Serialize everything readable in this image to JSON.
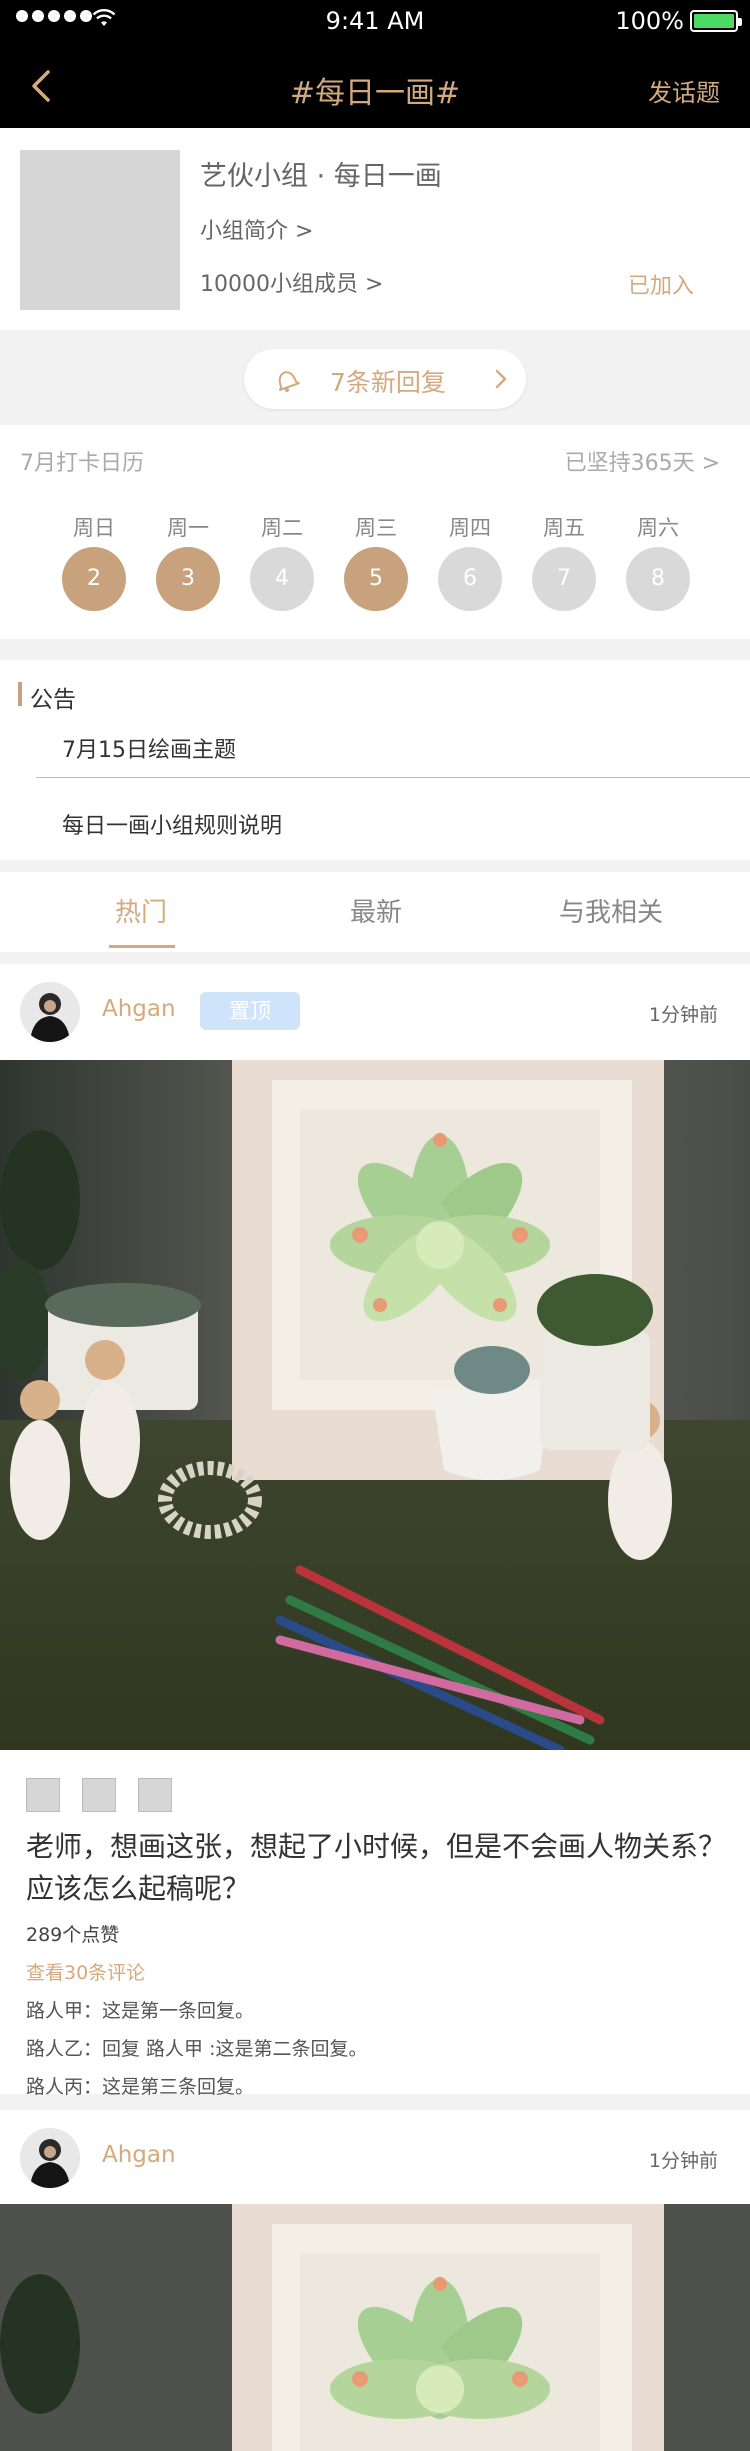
{
  "status_bar": {
    "time": "9:41 AM",
    "battery": "100%"
  },
  "nav": {
    "title": "#每日一画#",
    "action": "发话题"
  },
  "group": {
    "name": "艺伙小组 · 每日一画",
    "intro": "小组简介 >",
    "members": "10000小组成员 >",
    "status": "已加入"
  },
  "reply_pill": {
    "label": "7条新回复"
  },
  "calendar": {
    "title": "7月打卡日历",
    "streak": "已坚持365天 >",
    "days": [
      {
        "weekday": "周日",
        "date": "2",
        "checked": true
      },
      {
        "weekday": "周一",
        "date": "3",
        "checked": true
      },
      {
        "weekday": "周二",
        "date": "4",
        "checked": false
      },
      {
        "weekday": "周三",
        "date": "5",
        "checked": true
      },
      {
        "weekday": "周四",
        "date": "6",
        "checked": false
      },
      {
        "weekday": "周五",
        "date": "7",
        "checked": false
      },
      {
        "weekday": "周六",
        "date": "8",
        "checked": false
      }
    ],
    "checked_color": "#c8a27c",
    "unchecked_color": "#d9d9d9"
  },
  "notice": {
    "heading": "公告",
    "items": [
      "7月15日绘画主题",
      "每日一画小组规则说明"
    ]
  },
  "tabs": [
    "热门",
    "最新",
    "与我相关"
  ],
  "posts": [
    {
      "user": "Ahgan",
      "badge": "置顶",
      "time": "1分钟前",
      "text": "老师，想画这张，想起了小时候，但是不会画人物关系？应该怎么起稿呢？",
      "likes": "289个点赞",
      "see_comments": "查看30条评论",
      "comments": [
        "路人甲：这是第一条回复。",
        "路人乙：回复 路人甲 :这是第二条回复。",
        "路人丙：这是第三条回复。"
      ]
    },
    {
      "user": "Ahgan",
      "time": "1分钟前"
    }
  ],
  "colors": {
    "accent": "#d4aa7d",
    "badge_bg": "#cfe4fb"
  }
}
